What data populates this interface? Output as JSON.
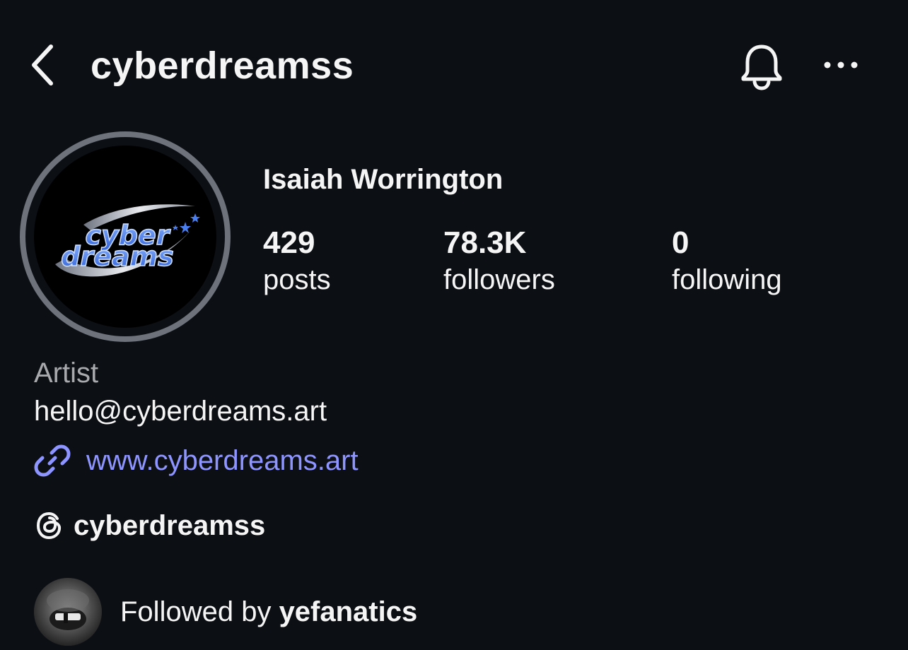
{
  "header": {
    "username": "cyberdreamss",
    "back_icon": "chevron-left-icon",
    "bell_icon": "bell-icon",
    "more_icon": "more-horizontal-icon"
  },
  "profile": {
    "full_name": "Isaiah Worrington",
    "avatar_text_line1": "cyber",
    "avatar_text_line2": "dreams",
    "stats": [
      {
        "value": "429",
        "label": "posts"
      },
      {
        "value": "78.3K",
        "label": "followers"
      },
      {
        "value": "0",
        "label": "following"
      }
    ]
  },
  "bio": {
    "category": "Artist",
    "email": "hello@cyberdreams.art",
    "link": "www.cyberdreams.art",
    "link_icon": "link-icon",
    "threads_handle": "cyberdreamss",
    "threads_icon": "threads-icon"
  },
  "followed_by": {
    "prefix": "Followed by ",
    "name": "yefanatics"
  },
  "colors": {
    "background": "#0c0f14",
    "text": "#f5f5f5",
    "muted": "#a7a9ad",
    "link": "#8e95ff",
    "avatar_ring": "#6e737b",
    "logo_blue": "#4a7ff0"
  }
}
